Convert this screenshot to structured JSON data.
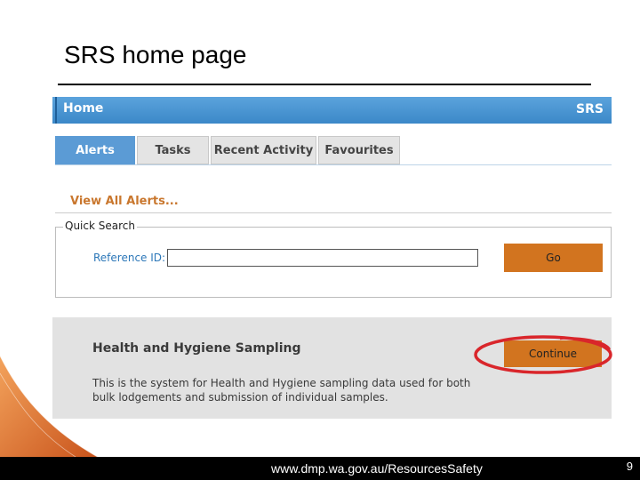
{
  "slide": {
    "title": "SRS home page",
    "footer_url": "www.dmp.wa.gov.au/ResourcesSafety",
    "page_number": "9"
  },
  "header": {
    "title": "Home",
    "brand": "SRS"
  },
  "tabs": [
    {
      "label": "Alerts",
      "active": true
    },
    {
      "label": "Tasks",
      "active": false
    },
    {
      "label": "Recent Activity",
      "active": false
    },
    {
      "label": "Favourites",
      "active": false
    }
  ],
  "alerts": {
    "view_all_label": "View All Alerts..."
  },
  "quick_search": {
    "legend": "Quick Search",
    "reference_label": "Reference ID:",
    "reference_value": "",
    "go_label": "Go"
  },
  "hygiene": {
    "title": "Health and Hygiene Sampling",
    "description": "This is the system for Health and Hygiene sampling data used for both bulk lodgements and submission of individual samples.",
    "continue_label": "Continue"
  },
  "colors": {
    "header_blue": "#3b88c8",
    "tab_active": "#5b9bd5",
    "button_orange": "#d2741f",
    "link_orange": "#c9772e",
    "highlight_red": "#d9262b"
  }
}
